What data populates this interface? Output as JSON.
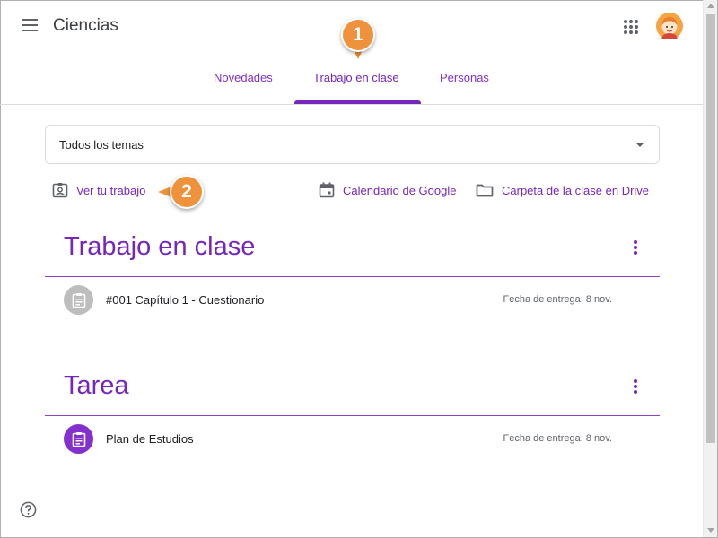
{
  "header": {
    "title": "Ciencias",
    "tabs": [
      {
        "label": "Novedades"
      },
      {
        "label": "Trabajo en clase"
      },
      {
        "label": "Personas"
      }
    ]
  },
  "topic_filter": {
    "value": "Todos los temas"
  },
  "links": {
    "view_work": "Ver tu trabajo",
    "calendar": "Calendario de Google",
    "drive": "Carpeta de la clase en Drive"
  },
  "callouts": {
    "first": "1",
    "second": "2"
  },
  "sections": [
    {
      "title": "Trabajo en clase",
      "items": [
        {
          "title": "#001 Capítulo 1 - Cuestionario",
          "due": "Fecha de entrega: 8 nov.",
          "icon": "assignment-icon",
          "color": "#bdbdbd"
        }
      ]
    },
    {
      "title": "Tarea",
      "items": [
        {
          "title": "Plan de Estudios",
          "due": "Fecha de entrega: 8 nov.",
          "icon": "assignment-icon",
          "color": "#8430ce"
        }
      ]
    }
  ],
  "colors": {
    "accent": "#7627bb",
    "callout": "#f0923b"
  }
}
